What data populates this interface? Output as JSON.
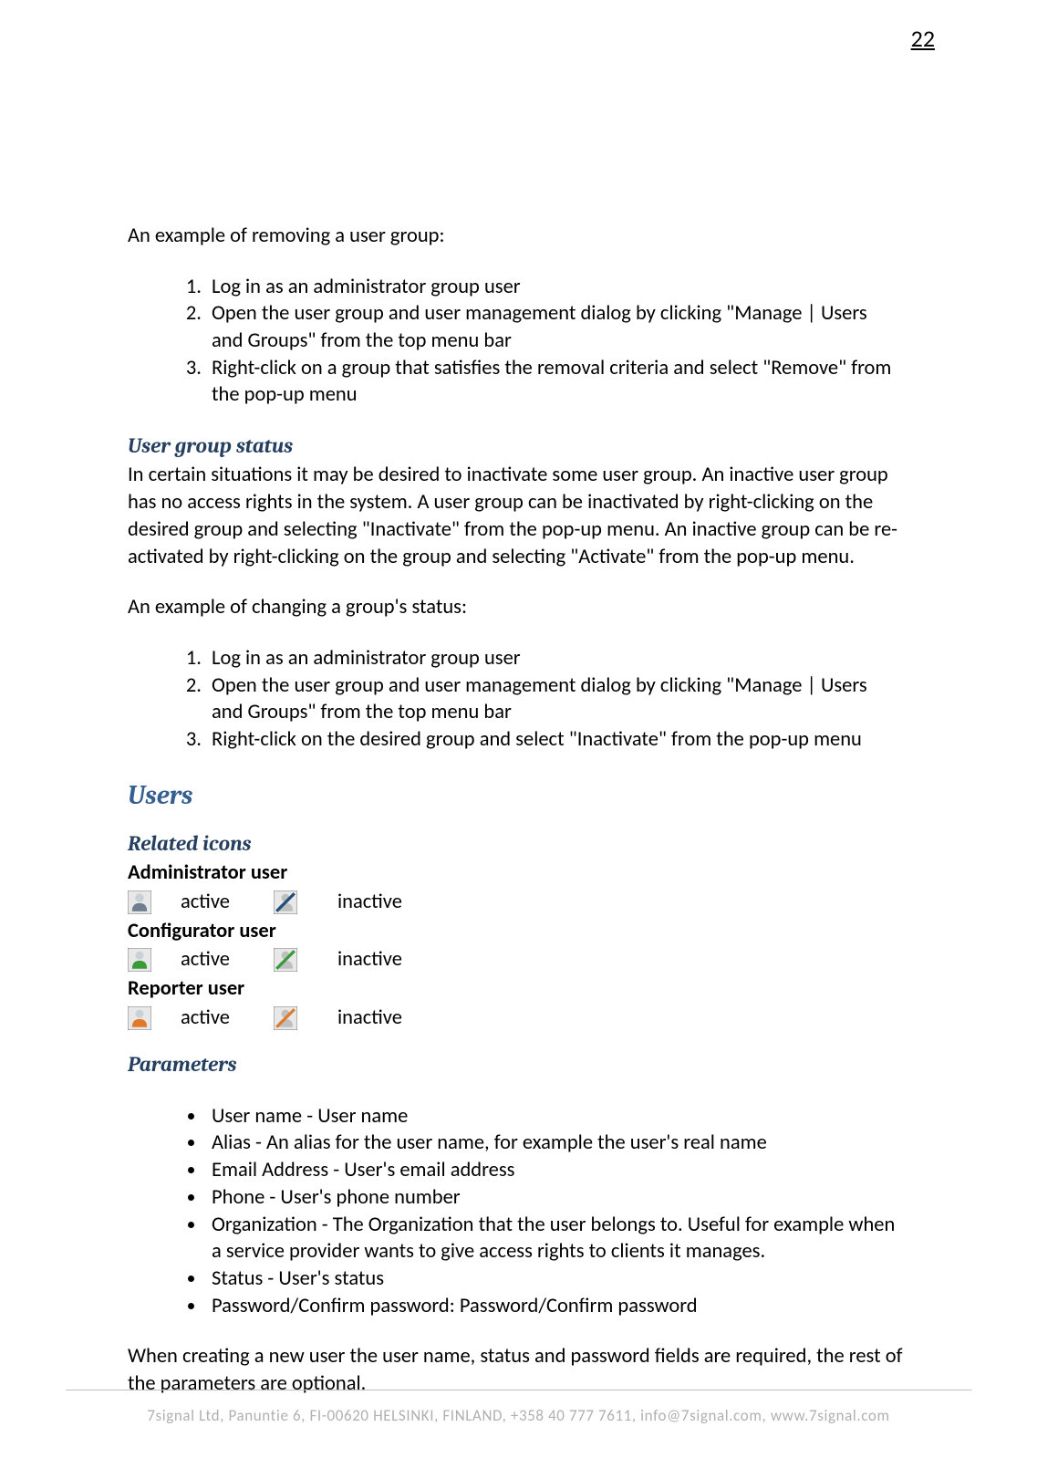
{
  "page_number": "22",
  "intro1": "An example of removing a user group:",
  "list1": {
    "i1": "Log in as an administrator group user",
    "i2": "Open the user group and user management dialog by clicking \"Manage | Users and Groups\" from the top menu bar",
    "i3": "Right-click on a group that satisfies the removal criteria and select \"Remove\" from the pop-up menu"
  },
  "h_status": "User group status",
  "status_para": "In certain situations it may be desired to inactivate some user group. An inactive user group has no access rights in the system. A user group can be inactivated by right-clicking on the desired group and selecting \"Inactivate\" from the pop-up menu. An inactive group can be re-activated by right-clicking on the group and selecting \"Activate\" from the pop-up menu.",
  "intro2": "An example of changing a group's status:",
  "list2": {
    "i1": "Log in as an administrator group user",
    "i2": "Open the user group and user management dialog by clicking \"Manage | Users and Groups\" from the top menu bar",
    "i3": "Right-click on the desired group and select \"Inactivate\" from the pop-up menu"
  },
  "h_users": "Users",
  "h_related": "Related icons",
  "types": {
    "admin": {
      "label": "Administrator user",
      "active": "active",
      "inactive": "inactive"
    },
    "config": {
      "label": "Configurator user",
      "active": "active",
      "inactive": "inactive"
    },
    "reporter": {
      "label": "Reporter user",
      "active": "active",
      "inactive": "inactive"
    }
  },
  "h_params": "Parameters",
  "params": {
    "p1": "User name - User name",
    "p2": "Alias - An alias for the user name, for example the user's real name",
    "p3": "Email Address - User's email address",
    "p4": "Phone - User's phone number",
    "p5": "Organization - The Organization that the user belongs to. Useful for example when a service provider wants to give access rights to clients it manages.",
    "p6": "Status - User's status",
    "p7": "Password/Confirm password: Password/Confirm password"
  },
  "closing": "When creating a new user the user name, status and password fields are required, the rest of the parameters are optional.",
  "footer": "7signal Ltd, Panuntie 6, FI-00620 HELSINKI, FINLAND, +358 40 777 7611, info@7signal.com, www.7signal.com"
}
